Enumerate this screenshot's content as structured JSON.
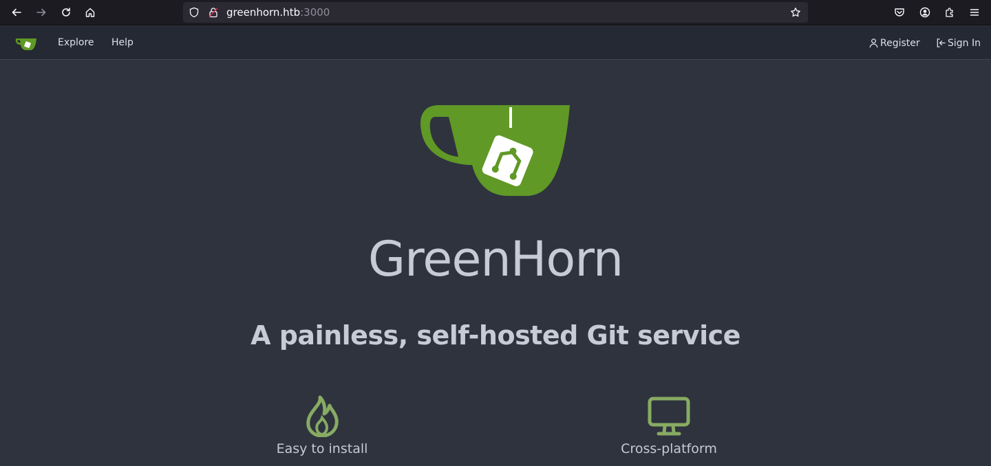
{
  "browser": {
    "url_host": "greenhorn.htb",
    "url_port": ":3000",
    "icons": [
      "back-icon",
      "forward-icon",
      "reload-icon",
      "home-icon",
      "shield-icon",
      "lock-icon",
      "bookmark-star-icon",
      "pocket-icon",
      "account-icon",
      "extensions-icon",
      "menu-icon"
    ]
  },
  "navbar": {
    "explore_label": "Explore",
    "help_label": "Help",
    "register_label": "Register",
    "signin_label": "Sign In"
  },
  "hero": {
    "title": "GreenHorn",
    "subtitle": "A painless, self-hosted Git service"
  },
  "features": [
    {
      "label": "Easy to install",
      "icon": "flame-icon"
    },
    {
      "label": "Cross-platform",
      "icon": "monitor-icon"
    }
  ],
  "colors": {
    "accent_green": "#609926",
    "icon_green": "#87ab63",
    "background": "#2f333e",
    "navbar": "#252933"
  }
}
